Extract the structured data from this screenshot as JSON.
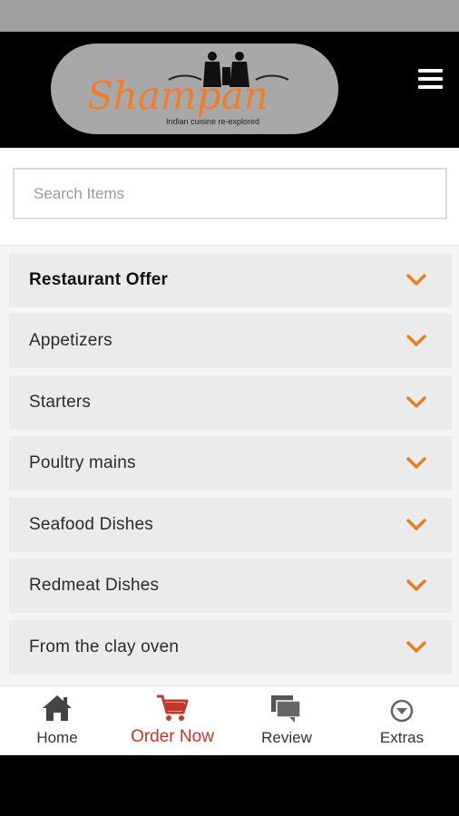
{
  "app": {
    "logo_text": "Shampan",
    "logo_tagline": "Indian cuisine re-explored"
  },
  "search": {
    "placeholder": "Search Items",
    "value": ""
  },
  "categories": [
    {
      "label": "Restaurant Offer"
    },
    {
      "label": "Appetizers"
    },
    {
      "label": "Starters"
    },
    {
      "label": "Poultry mains"
    },
    {
      "label": "Seafood Dishes"
    },
    {
      "label": "Redmeat Dishes"
    },
    {
      "label": "From the clay oven"
    }
  ],
  "tabs": [
    {
      "label": "Home",
      "icon": "home-icon"
    },
    {
      "label": "Order Now",
      "icon": "cart-icon",
      "active": true
    },
    {
      "label": "Review",
      "icon": "chat-icon"
    },
    {
      "label": "Extras",
      "icon": "chevron-circle-icon"
    }
  ],
  "colors": {
    "accent": "#e67e22",
    "active_tab": "#c0392b",
    "header_bg": "#000000"
  }
}
